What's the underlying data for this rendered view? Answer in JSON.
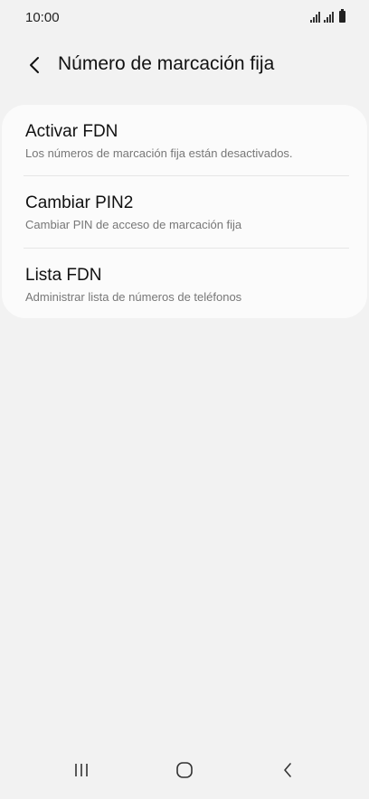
{
  "status_bar": {
    "time": "10:00",
    "icons": [
      "signal-icon",
      "signal-icon",
      "battery-icon"
    ]
  },
  "header": {
    "back_icon": "chevron-left-icon",
    "title": "Número de marcación fija"
  },
  "items": [
    {
      "title": "Activar FDN",
      "subtitle": "Los números de marcación fija están desactivados."
    },
    {
      "title": "Cambiar PIN2",
      "subtitle": "Cambiar PIN de acceso de marcación fija"
    },
    {
      "title": "Lista FDN",
      "subtitle": "Administrar lista de números de teléfonos"
    }
  ],
  "navbar": {
    "icons": [
      "recent-apps-icon",
      "home-icon",
      "back-icon"
    ]
  },
  "colors": {
    "background": "#f2f2f2",
    "card": "#fbfbfb",
    "text_primary": "#111111",
    "text_secondary": "#777777"
  }
}
